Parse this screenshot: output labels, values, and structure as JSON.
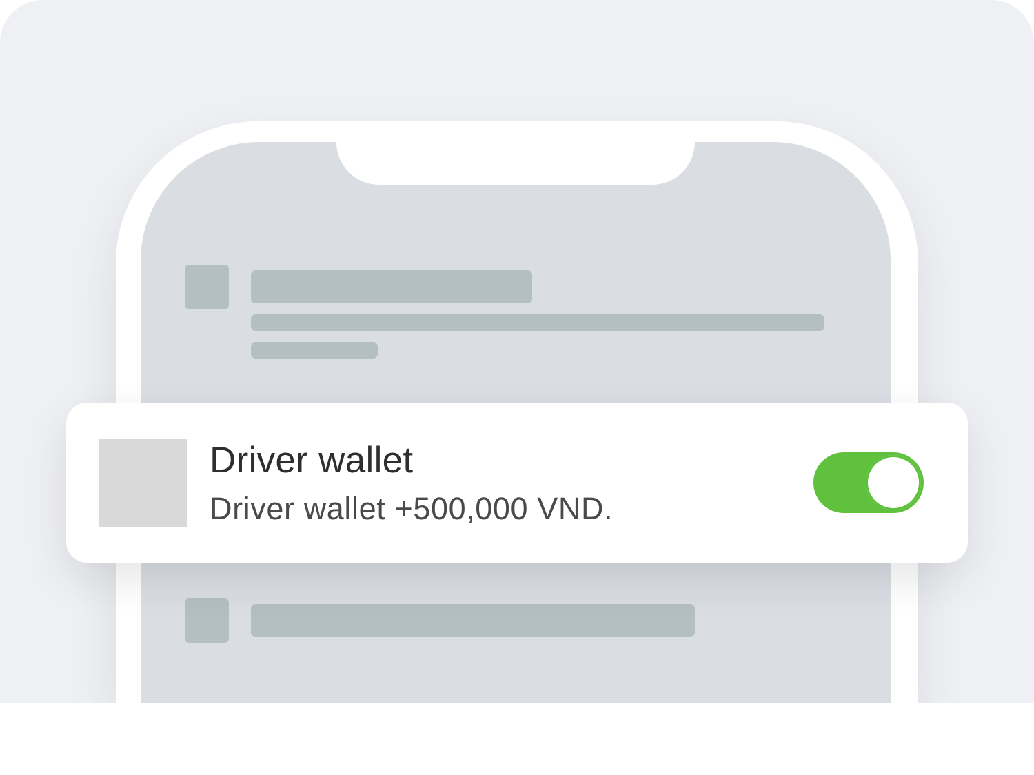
{
  "notification": {
    "title": "Driver wallet",
    "body": "Driver wallet +500,000 VND.",
    "toggle": {
      "on": true,
      "accent_color": "#5fc13e"
    }
  },
  "colors": {
    "backdrop": "#eff0f3",
    "phone_frame": "#ffffff",
    "phone_screen": "#dadde2",
    "skeleton": "#b4bfc3",
    "app_thumb": "#d9d9d9"
  }
}
